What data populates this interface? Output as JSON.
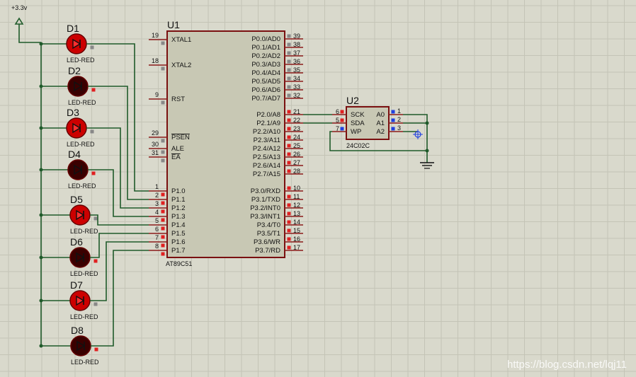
{
  "power": {
    "label": "+3.3v"
  },
  "u1": {
    "ref": "U1",
    "part": "AT89C51",
    "left_pins": [
      {
        "num": "19",
        "name": "XTAL1",
        "over": false
      },
      {
        "num": "18",
        "name": "XTAL2",
        "over": false
      },
      {
        "num": "9",
        "name": "RST",
        "over": false
      },
      {
        "num": "29",
        "name": "PSEN",
        "over": true
      },
      {
        "num": "30",
        "name": "ALE",
        "over": false
      },
      {
        "num": "31",
        "name": "EA",
        "over": true
      },
      {
        "num": "1",
        "name": "P1.0",
        "over": false
      },
      {
        "num": "2",
        "name": "P1.1",
        "over": false
      },
      {
        "num": "3",
        "name": "P1.2",
        "over": false
      },
      {
        "num": "4",
        "name": "P1.3",
        "over": false
      },
      {
        "num": "5",
        "name": "P1.4",
        "over": false
      },
      {
        "num": "6",
        "name": "P1.5",
        "over": false
      },
      {
        "num": "7",
        "name": "P1.6",
        "over": false
      },
      {
        "num": "8",
        "name": "P1.7",
        "over": false
      }
    ],
    "right_pins": [
      {
        "num": "39",
        "name": "P0.0/AD0"
      },
      {
        "num": "38",
        "name": "P0.1/AD1"
      },
      {
        "num": "37",
        "name": "P0.2/AD2"
      },
      {
        "num": "36",
        "name": "P0.3/AD3"
      },
      {
        "num": "35",
        "name": "P0.4/AD4"
      },
      {
        "num": "34",
        "name": "P0.5/AD5"
      },
      {
        "num": "33",
        "name": "P0.6/AD6"
      },
      {
        "num": "32",
        "name": "P0.7/AD7"
      },
      {
        "num": "21",
        "name": "P2.0/A8"
      },
      {
        "num": "22",
        "name": "P2.1/A9"
      },
      {
        "num": "23",
        "name": "P2.2/A10"
      },
      {
        "num": "24",
        "name": "P2.3/A11"
      },
      {
        "num": "25",
        "name": "P2.4/A12"
      },
      {
        "num": "26",
        "name": "P2.5/A13"
      },
      {
        "num": "27",
        "name": "P2.6/A14"
      },
      {
        "num": "28",
        "name": "P2.7/A15"
      },
      {
        "num": "10",
        "name": "P3.0/RXD"
      },
      {
        "num": "11",
        "name": "P3.1/TXD"
      },
      {
        "num": "12",
        "name": "P3.2/INT0"
      },
      {
        "num": "13",
        "name": "P3.3/INT1"
      },
      {
        "num": "14",
        "name": "P3.4/T0"
      },
      {
        "num": "15",
        "name": "P3.5/T1"
      },
      {
        "num": "16",
        "name": "P3.6/WR"
      },
      {
        "num": "17",
        "name": "P3.7/RD"
      }
    ]
  },
  "u2": {
    "ref": "U2",
    "part": "24C02C",
    "left_pins": [
      {
        "num": "6",
        "name": "SCK"
      },
      {
        "num": "5",
        "name": "SDA"
      },
      {
        "num": "7",
        "name": "WP"
      }
    ],
    "right_pins": [
      {
        "num": "1",
        "name": "A0"
      },
      {
        "num": "2",
        "name": "A1"
      },
      {
        "num": "3",
        "name": "A2"
      }
    ]
  },
  "leds": [
    {
      "ref": "D1",
      "part": "LED-RED",
      "lit": true
    },
    {
      "ref": "D2",
      "part": "LED-RED",
      "lit": false
    },
    {
      "ref": "D3",
      "part": "LED-RED",
      "lit": true
    },
    {
      "ref": "D4",
      "part": "LED-RED",
      "lit": false
    },
    {
      "ref": "D5",
      "part": "LED-RED",
      "lit": true
    },
    {
      "ref": "D6",
      "part": "LED-RED",
      "lit": false
    },
    {
      "ref": "D7",
      "part": "LED-RED",
      "lit": true
    },
    {
      "ref": "D8",
      "part": "LED-RED",
      "lit": false
    }
  ],
  "colors": {
    "wire": "#1f5a2a",
    "chip_fill": "#c8c8b4",
    "chip_border": "#7a1010",
    "led_lit": "#cc0000",
    "led_off": "#3a0000",
    "pin_red": "#e02020",
    "pin_grey": "#888888",
    "pin_blue": "#2040e0"
  },
  "watermark": "https://blog.csdn.net/lqj11"
}
